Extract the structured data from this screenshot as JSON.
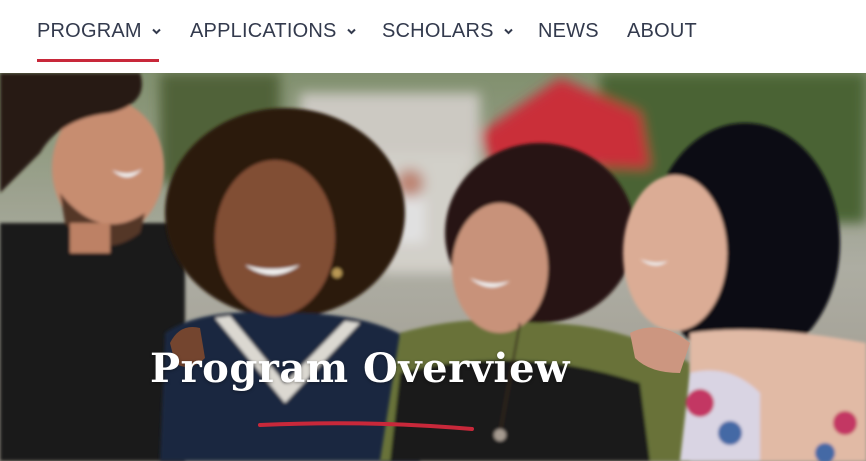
{
  "nav": {
    "items": [
      {
        "label": "PROGRAM",
        "has_dropdown": true,
        "active": true
      },
      {
        "label": "APPLICATIONS",
        "has_dropdown": true,
        "active": false
      },
      {
        "label": "SCHOLARS",
        "has_dropdown": true,
        "active": false
      },
      {
        "label": "NEWS",
        "has_dropdown": false,
        "active": false
      },
      {
        "label": "ABOUT",
        "has_dropdown": false,
        "active": false
      }
    ],
    "dropdown_icon": "chevron-down-icon"
  },
  "hero": {
    "title": "Program Overview",
    "image": "photo-of-four-smiling-friends"
  },
  "colors": {
    "nav_text": "#333a4d",
    "accent": "#c8283a",
    "background": "#ffffff",
    "hero_title": "#ffffff"
  }
}
